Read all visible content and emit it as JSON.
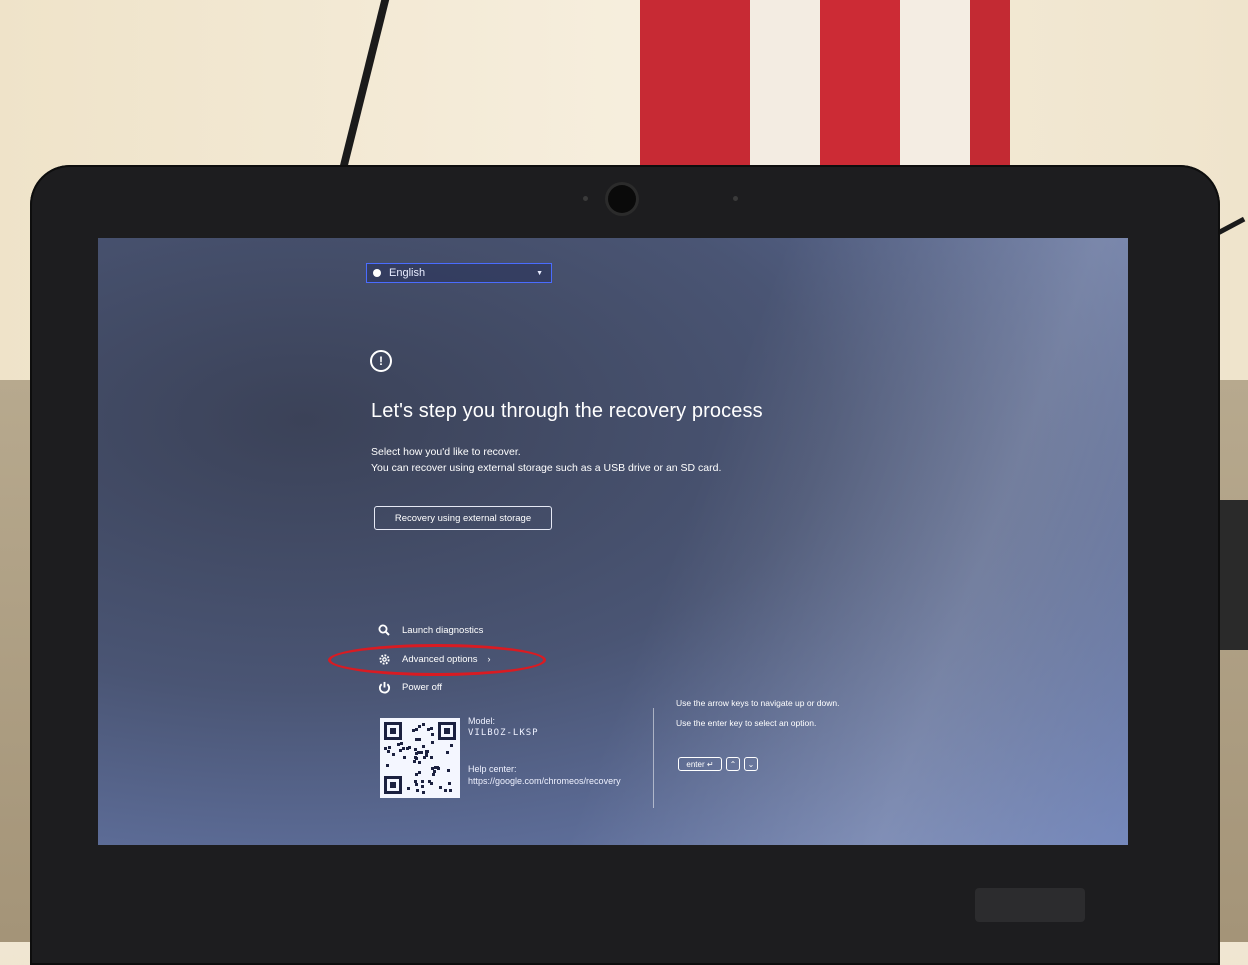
{
  "language_selector": {
    "value": "English"
  },
  "recovery": {
    "title": "Let's step you through the recovery process",
    "line1": "Select how you'd like to recover.",
    "line2": "You can recover using external storage such as a USB drive or an SD card.",
    "button_label": "Recovery using external storage"
  },
  "options": [
    {
      "label": "Launch diagnostics",
      "icon": "search-icon"
    },
    {
      "label": "Advanced options",
      "icon": "gear-icon"
    },
    {
      "label": "Power off",
      "icon": "power-icon"
    }
  ],
  "device": {
    "model_label": "Model:",
    "model_value": "VILBOZ-LKSP",
    "help_label": "Help center:",
    "help_url": "https://google.com/chromeos/recovery"
  },
  "hints": {
    "line1": "Use the arrow keys to navigate up or down.",
    "line2": "Use the enter key to select an option.",
    "enter_key": "enter ↵",
    "up_key": "⌃",
    "down_key": "⌄"
  },
  "colors": {
    "highlight_ellipse": "#d91b22",
    "focus_border": "#4a6cff"
  }
}
